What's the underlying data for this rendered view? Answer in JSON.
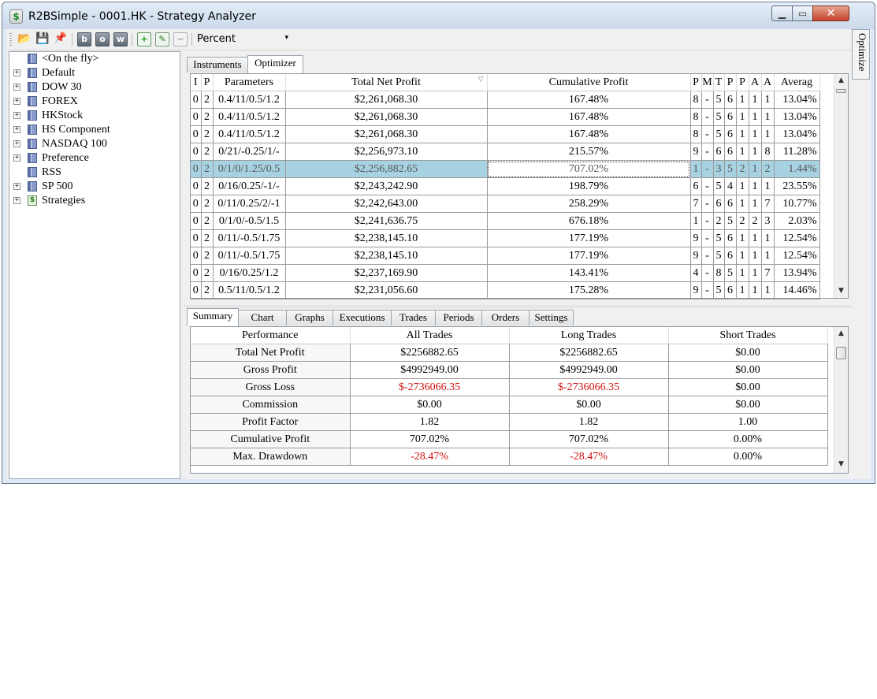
{
  "window": {
    "title": "R2BSimple - 0001.HK - Strategy Analyzer",
    "close_glyph": "✕",
    "min_glyph": "▁",
    "max_glyph": "▭"
  },
  "toolbar": {
    "combo_value": "Percent",
    "combo_arrow": "▾",
    "b_label": "b",
    "o_label": "o",
    "w_label": "w",
    "open_icon": "📂",
    "save_icon": "💾",
    "pin_icon": "📌",
    "plus_icon": "+",
    "edit_icon": "✎",
    "minus_icon": "−"
  },
  "tree": {
    "items": [
      {
        "label": "<On the fly>",
        "expandable": false,
        "icon": "instrument-list-icon"
      },
      {
        "label": "Default",
        "expandable": true,
        "icon": "instrument-list-icon"
      },
      {
        "label": "DOW 30",
        "expandable": true,
        "icon": "instrument-list-icon"
      },
      {
        "label": "FOREX",
        "expandable": true,
        "icon": "instrument-list-icon"
      },
      {
        "label": "HKStock",
        "expandable": true,
        "icon": "instrument-list-icon"
      },
      {
        "label": "HS Component",
        "expandable": true,
        "icon": "instrument-list-icon"
      },
      {
        "label": "NASDAQ 100",
        "expandable": true,
        "icon": "instrument-list-icon"
      },
      {
        "label": "Preference",
        "expandable": true,
        "icon": "instrument-list-icon"
      },
      {
        "label": "RSS",
        "expandable": false,
        "icon": "instrument-list-icon"
      },
      {
        "label": "SP 500",
        "expandable": true,
        "icon": "instrument-list-icon"
      },
      {
        "label": "Strategies",
        "expandable": true,
        "icon": "strategy-icon",
        "icon_glyph": "$"
      }
    ],
    "expander": "+"
  },
  "top_tabs": [
    "Instruments",
    "Optimizer"
  ],
  "side_tab": "Optimize",
  "optimizer": {
    "headers": [
      "I",
      "P",
      "Parameters",
      "Total Net Profit",
      "Cumulative Profit",
      "P",
      "M",
      "T",
      "P",
      "P",
      "A",
      "A",
      "Averag"
    ],
    "sort_glyph": "▽",
    "rows": [
      [
        "0",
        "2",
        "0.4/11/0.5/1.2",
        "$2,261,068.30",
        "167.48%",
        "8",
        "-",
        "5",
        "6",
        "1",
        "1",
        "1",
        "13.04%"
      ],
      [
        "0",
        "2",
        "0.4/11/0.5/1.2",
        "$2,261,068.30",
        "167.48%",
        "8",
        "-",
        "5",
        "6",
        "1",
        "1",
        "1",
        "13.04%"
      ],
      [
        "0",
        "2",
        "0.4/11/0.5/1.2",
        "$2,261,068.30",
        "167.48%",
        "8",
        "-",
        "5",
        "6",
        "1",
        "1",
        "1",
        "13.04%"
      ],
      [
        "0",
        "2",
        "0/21/-0.25/1/-",
        "$2,256,973.10",
        "215.57%",
        "9",
        "-",
        "6",
        "6",
        "1",
        "1",
        "8",
        "11.28%"
      ],
      [
        "0",
        "2",
        "0/1/0/1.25/0.5",
        "$2,256,882.65",
        "707.02%",
        "1",
        "-",
        "3",
        "5",
        "2",
        "1",
        "2",
        "1.44%"
      ],
      [
        "0",
        "2",
        "0/16/0.25/-1/-",
        "$2,243,242.90",
        "198.79%",
        "6",
        "-",
        "5",
        "4",
        "1",
        "1",
        "1",
        "23.55%"
      ],
      [
        "0",
        "2",
        "0/11/0.25/2/-1",
        "$2,242,643.00",
        "258.29%",
        "7",
        "-",
        "6",
        "6",
        "1",
        "1",
        "7",
        "10.77%"
      ],
      [
        "0",
        "2",
        "0/1/0/-0.5/1.5",
        "$2,241,636.75",
        "676.18%",
        "1",
        "-",
        "2",
        "5",
        "2",
        "2",
        "3",
        "2.03%"
      ],
      [
        "0",
        "2",
        "0/11/-0.5/1.75",
        "$2,238,145.10",
        "177.19%",
        "9",
        "-",
        "5",
        "6",
        "1",
        "1",
        "1",
        "12.54%"
      ],
      [
        "0",
        "2",
        "0/11/-0.5/1.75",
        "$2,238,145.10",
        "177.19%",
        "9",
        "-",
        "5",
        "6",
        "1",
        "1",
        "1",
        "12.54%"
      ],
      [
        "0",
        "2",
        "0/16/0.25/1.2",
        "$2,237,169.90",
        "143.41%",
        "4",
        "-",
        "8",
        "5",
        "1",
        "1",
        "7",
        "13.94%"
      ],
      [
        "0",
        "2",
        "0.5/11/0.5/1.2",
        "$2,231,056.60",
        "175.28%",
        "9",
        "-",
        "5",
        "6",
        "1",
        "1",
        "1",
        "14.46%"
      ]
    ],
    "selected_row": 4
  },
  "bottom_tabs": [
    "Summary",
    "Chart",
    "Graphs",
    "Executions",
    "Trades",
    "Periods",
    "Orders",
    "Settings"
  ],
  "summary": {
    "headers": [
      "Performance",
      "All Trades",
      "Long Trades",
      "Short Trades"
    ],
    "rows": [
      {
        "cells": [
          "Total Net Profit",
          "$2256882.65",
          "$2256882.65",
          "$0.00"
        ],
        "neg": false
      },
      {
        "cells": [
          "Gross Profit",
          "$4992949.00",
          "$4992949.00",
          "$0.00"
        ],
        "neg": false
      },
      {
        "cells": [
          "Gross Loss",
          "$-2736066.35",
          "$-2736066.35",
          "$0.00"
        ],
        "neg": true
      },
      {
        "cells": [
          "Commission",
          "$0.00",
          "$0.00",
          "$0.00"
        ],
        "neg": false
      },
      {
        "cells": [
          "Profit Factor",
          "1.82",
          "1.82",
          "1.00"
        ],
        "neg": false
      },
      {
        "cells": [
          "Cumulative Profit",
          "707.02%",
          "707.02%",
          "0.00%"
        ],
        "neg": false
      },
      {
        "cells": [
          "Max. Drawdown",
          "-28.47%",
          "-28.47%",
          "0.00%"
        ],
        "neg": true
      }
    ]
  },
  "scroll": {
    "up": "▲",
    "down": "▼"
  }
}
